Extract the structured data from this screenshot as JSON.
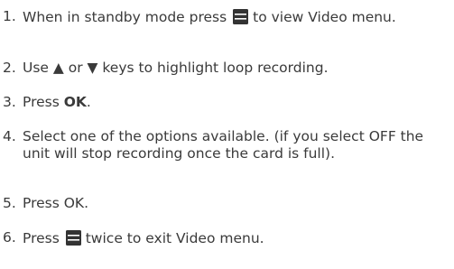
{
  "colors": {
    "text": "#3a3a3a",
    "icon": "#333333"
  },
  "instructions": [
    {
      "number": "1.",
      "parts": [
        "When in standby mode press",
        "menu-icon",
        "to view Video menu."
      ]
    },
    {
      "number": "2.",
      "text": "Use ▲ or ▼ keys to highlight loop recording."
    },
    {
      "number": "3.",
      "prefix": "Press ",
      "bold": "OK",
      "suffix": "."
    },
    {
      "number": "4.",
      "text": "Select one of the options available. (if you select OFF the unit will stop recording once the card is full)."
    },
    {
      "number": "5.",
      "text": "Press OK."
    },
    {
      "number": "6.",
      "parts": [
        "Press",
        "menu-icon",
        "twice to exit Video menu."
      ]
    }
  ]
}
